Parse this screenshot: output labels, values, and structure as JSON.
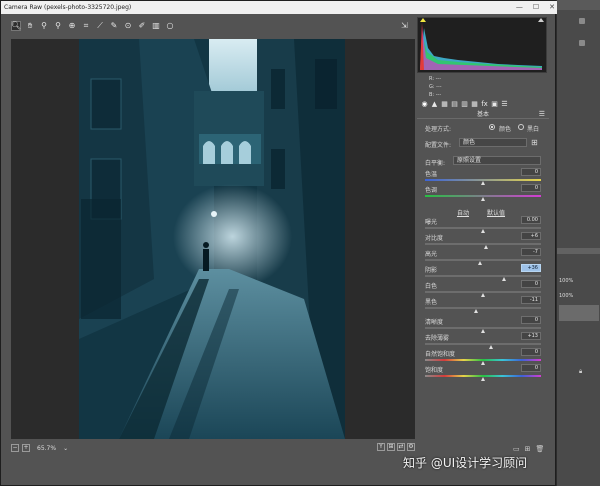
{
  "window": {
    "title": "Camera Raw (pexels-photo-3325720.jpeg)",
    "controls": [
      "—",
      "☐",
      "✕"
    ]
  },
  "toolbar": {
    "tools": [
      {
        "name": "zoom-tool-icon",
        "glyph": "🔍︎"
      },
      {
        "name": "hand-tool-icon",
        "glyph": "✋︎"
      },
      {
        "name": "white-balance-tool-icon",
        "glyph": "⚲"
      },
      {
        "name": "color-sampler-tool-icon",
        "glyph": "⚲"
      },
      {
        "name": "targeted-adjustment-tool-icon",
        "glyph": "⊕"
      },
      {
        "name": "crop-tool-icon",
        "glyph": "⌗"
      },
      {
        "name": "straighten-tool-icon",
        "glyph": "⟋"
      },
      {
        "name": "spot-removal-tool-icon",
        "glyph": "✎"
      },
      {
        "name": "red-eye-tool-icon",
        "glyph": "⊙"
      },
      {
        "name": "adjustment-brush-icon",
        "glyph": "✐"
      },
      {
        "name": "graduated-filter-icon",
        "glyph": "▥"
      },
      {
        "name": "radial-filter-icon",
        "glyph": "○"
      }
    ],
    "export_glyph": "⇲"
  },
  "bottombar": {
    "zoom_value": "65.7%",
    "zoom_minus": "−",
    "zoom_plus": "+",
    "dropdown_glyph": "⌄",
    "view_buttons": [
      "Y",
      "⊞",
      "⇄",
      "⚙"
    ]
  },
  "histogram": {
    "readout": [
      "R:",
      "G:",
      "B:"
    ],
    "dashes": "---"
  },
  "panel": {
    "tabs": [
      "◉",
      "▲",
      "▦",
      "▤",
      "▥",
      "▦",
      "fx",
      "▣",
      "☰"
    ],
    "section_title": "基本",
    "menu_glyph": "☰",
    "treatment_label": "处理方式:",
    "treatment_color": "颜色",
    "treatment_bw": "黑白",
    "profile_label": "配置文件:",
    "profile_value": "颜色",
    "profile_grid_glyph": "⊞",
    "wb_label": "白平衡:",
    "wb_value": "原照设置",
    "auto_label": "自动",
    "default_label": "默认值",
    "sliders": [
      {
        "label": "色温",
        "value": "0",
        "pos": 0.5
      },
      {
        "label": "色调",
        "value": "0",
        "pos": 0.5
      },
      {
        "label": "曝光",
        "value": "0.00",
        "pos": 0.5
      },
      {
        "label": "对比度",
        "value": "+6",
        "pos": 0.53
      },
      {
        "label": "高光",
        "value": "-7",
        "pos": 0.47
      },
      {
        "label": "阴影",
        "value": "+36",
        "pos": 0.68,
        "highlight": true
      },
      {
        "label": "白色",
        "value": "0",
        "pos": 0.5
      },
      {
        "label": "黑色",
        "value": "-11",
        "pos": 0.44
      },
      {
        "label": "清晰度",
        "value": "0",
        "pos": 0.5
      },
      {
        "label": "去除薄雾",
        "value": "+13",
        "pos": 0.57
      },
      {
        "label": "自然饱和度",
        "value": "0",
        "pos": 0.5
      },
      {
        "label": "饱和度",
        "value": "0",
        "pos": 0.5
      }
    ]
  },
  "background_panel": {
    "pct_1": "100%",
    "pct_2": "100%"
  },
  "watermark": "知乎 @UI设计学习顾问",
  "bottom_icons": [
    "▭",
    "⊞",
    "🗑︎"
  ],
  "colors": {
    "accent_highlight": "#9ec2e8",
    "photo_tint": "#1f4f60"
  }
}
